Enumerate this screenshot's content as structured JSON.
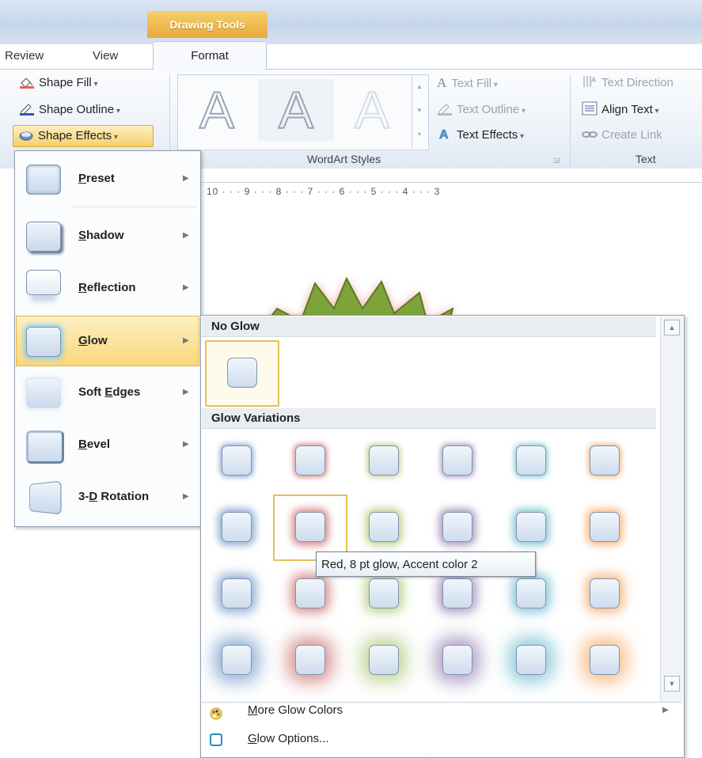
{
  "ribbon": {
    "contextual_tab": "Drawing Tools",
    "tabs": [
      "Review",
      "View",
      "Format"
    ],
    "shape_styles": {
      "fill": "Shape Fill",
      "outline": "Shape Outline",
      "effects": "Shape Effects"
    },
    "wordart": {
      "group_label": "WordArt Styles",
      "sample_glyph": "A",
      "text_fill": "Text Fill",
      "text_outline": "Text Outline",
      "text_effects": "Text Effects"
    },
    "text_group": {
      "group_label": "Text",
      "direction": "Text Direction",
      "align": "Align Text",
      "create_link": "Create Link"
    }
  },
  "ruler": {
    "ticks": "10 · · · 9 · · · 8 · · · 7 · · · 6 · · · 5 · · · 4 · · · 3"
  },
  "effects_menu": {
    "items": [
      {
        "label": "Preset",
        "mnemonic": "P",
        "rest": "reset"
      },
      {
        "label": "Shadow",
        "mnemonic": "S",
        "rest": "hadow"
      },
      {
        "label": "Reflection",
        "mnemonic": "R",
        "rest": "eflection"
      },
      {
        "label": "Glow",
        "mnemonic": "G",
        "rest": "low",
        "highlighted": true
      },
      {
        "label": "Soft Edges",
        "pre": "Soft ",
        "mnemonic": "E",
        "rest": "dges"
      },
      {
        "label": "Bevel",
        "mnemonic": "B",
        "rest": "evel"
      },
      {
        "label": "3-D Rotation",
        "pre": "3-",
        "mnemonic": "D",
        "rest": " Rotation"
      }
    ]
  },
  "glow_gallery": {
    "no_glow_header": "No Glow",
    "variations_header": "Glow Variations",
    "accent_colors": [
      "#4f81bd",
      "#c0504d",
      "#9bbb59",
      "#8064a2",
      "#4bacc6",
      "#f79646"
    ],
    "glow_sizes_pt": [
      5,
      8,
      11,
      18
    ],
    "selected": {
      "row": 2,
      "col": 2
    },
    "tooltip": "Red, 8 pt glow, Accent color 2",
    "more_colors": "More Glow Colors",
    "options": "Glow Options...",
    "more_mnemonic": "M",
    "more_rest": "ore Glow Colors",
    "options_mnemonic": "G",
    "options_rest": "low Options..."
  },
  "colors": {
    "highlight": "#f9d77c",
    "star_fill": "#7ea33a",
    "star_glow": "#e8625a"
  }
}
